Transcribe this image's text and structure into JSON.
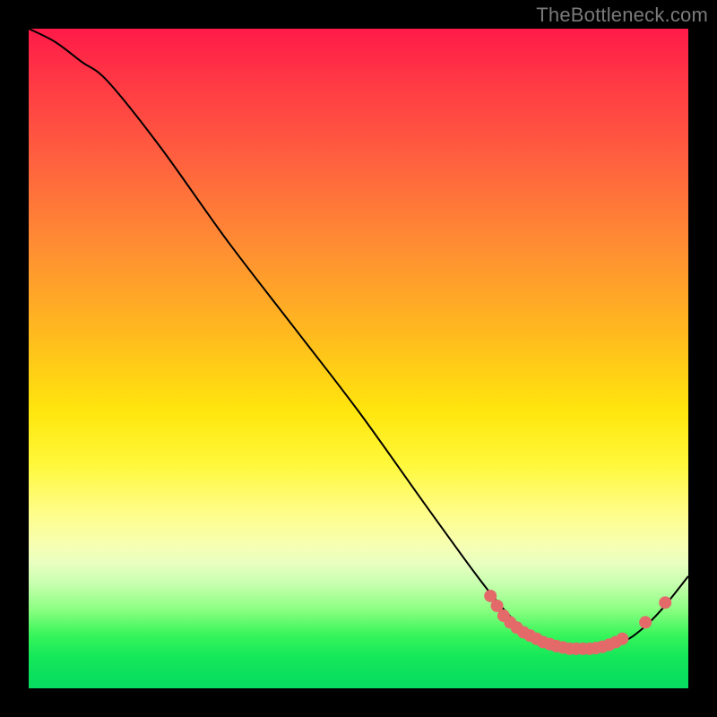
{
  "watermark": "TheBottleneck.com",
  "chart_data": {
    "type": "line",
    "title": "",
    "xlabel": "",
    "ylabel": "",
    "xlim": [
      0,
      100
    ],
    "ylim": [
      0,
      100
    ],
    "grid": false,
    "note": "Axes unlabeled in source image; values are relative pixel-space coordinates (0–100) with y=100 at top descending to 0 at bottom",
    "series": [
      {
        "name": "curve",
        "x": [
          0,
          4,
          8,
          12,
          20,
          30,
          40,
          50,
          60,
          68,
          72,
          75,
          78,
          82,
          86,
          90,
          93,
          96,
          100
        ],
        "y": [
          100,
          98,
          95,
          92,
          82,
          68,
          55,
          42,
          28,
          17,
          12,
          9,
          7,
          6,
          6,
          7,
          9,
          12,
          17
        ],
        "stroke": "#000000",
        "stroke_width": 2
      }
    ],
    "markers": {
      "name": "bottom-dots",
      "note": "Dense salmon dots along the valley of the curve, with two stray dots on the rising tail",
      "color": "#e46a6a",
      "radius": 7,
      "points": [
        {
          "x": 70,
          "y": 14
        },
        {
          "x": 71,
          "y": 12.5
        },
        {
          "x": 72,
          "y": 11
        },
        {
          "x": 73,
          "y": 10
        },
        {
          "x": 74,
          "y": 9.2
        },
        {
          "x": 75,
          "y": 8.5
        },
        {
          "x": 76,
          "y": 8
        },
        {
          "x": 77,
          "y": 7.5
        },
        {
          "x": 78,
          "y": 7
        },
        {
          "x": 79,
          "y": 6.7
        },
        {
          "x": 80,
          "y": 6.4
        },
        {
          "x": 81,
          "y": 6.2
        },
        {
          "x": 82,
          "y": 6
        },
        {
          "x": 83,
          "y": 6
        },
        {
          "x": 84,
          "y": 6
        },
        {
          "x": 85,
          "y": 6
        },
        {
          "x": 86,
          "y": 6.1
        },
        {
          "x": 87,
          "y": 6.3
        },
        {
          "x": 88,
          "y": 6.6
        },
        {
          "x": 89,
          "y": 7
        },
        {
          "x": 90,
          "y": 7.5
        },
        {
          "x": 93.5,
          "y": 10
        },
        {
          "x": 96.5,
          "y": 13
        }
      ]
    }
  }
}
